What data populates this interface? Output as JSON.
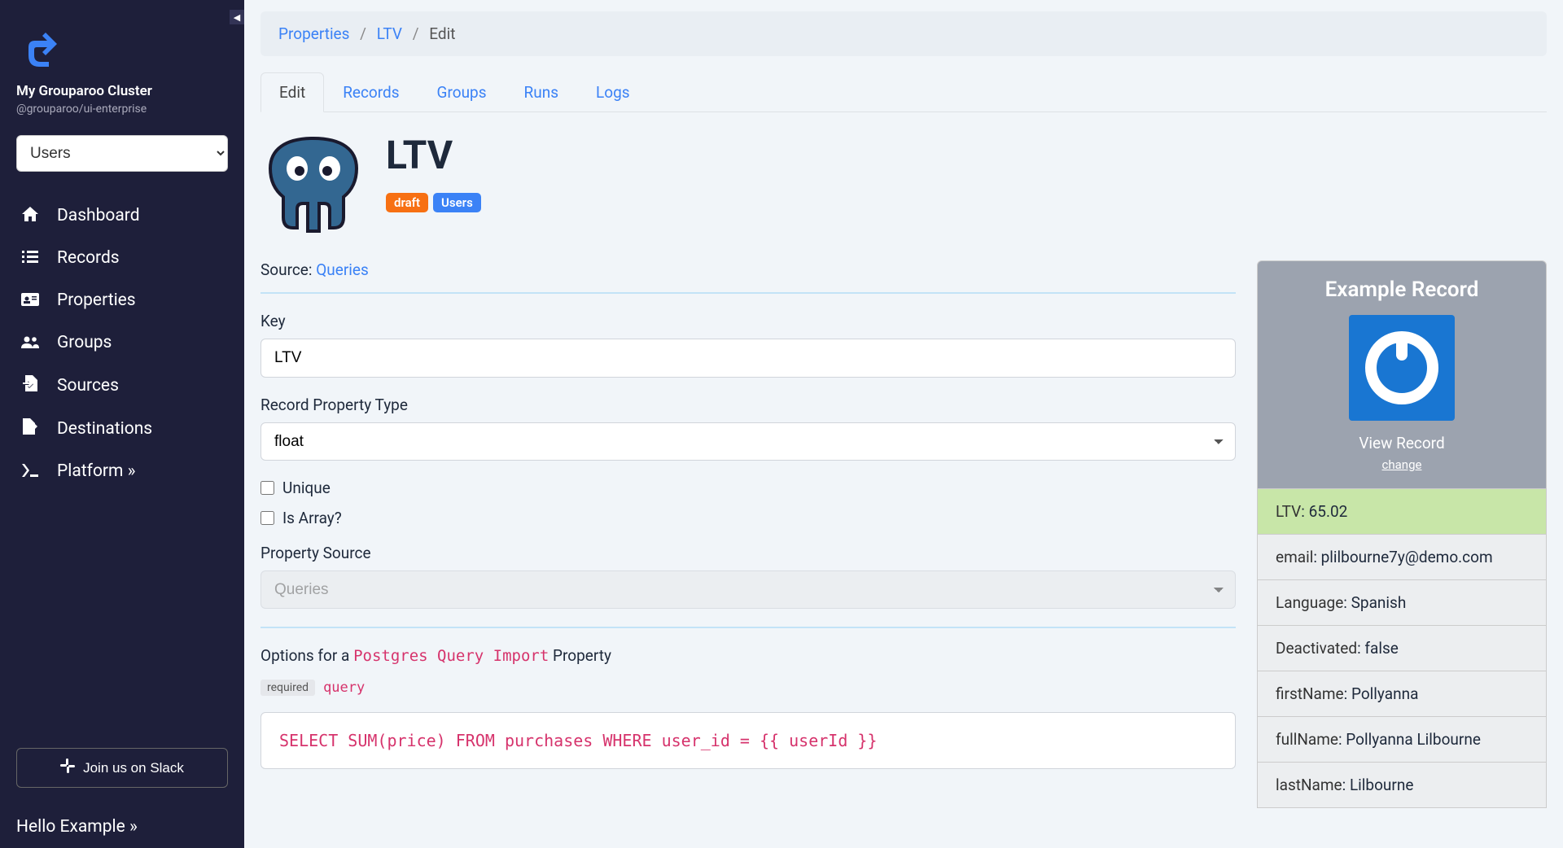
{
  "sidebar": {
    "cluster_name": "My Grouparoo Cluster",
    "cluster_sub": "@grouparoo/ui-enterprise",
    "model_selected": "Users",
    "nav": [
      {
        "label": "Dashboard",
        "icon": "home"
      },
      {
        "label": "Records",
        "icon": "list"
      },
      {
        "label": "Properties",
        "icon": "id-card"
      },
      {
        "label": "Groups",
        "icon": "users"
      },
      {
        "label": "Sources",
        "icon": "file-import"
      },
      {
        "label": "Destinations",
        "icon": "file-export"
      },
      {
        "label": "Platform »",
        "icon": "terminal"
      }
    ],
    "slack_label": "Join us on Slack",
    "hello": "Hello Example »"
  },
  "breadcrumb": {
    "items": [
      "Properties",
      "LTV",
      "Edit"
    ]
  },
  "tabs": [
    "Edit",
    "Records",
    "Groups",
    "Runs",
    "Logs"
  ],
  "active_tab": "Edit",
  "page": {
    "title": "LTV",
    "badge_draft": "draft",
    "badge_model": "Users",
    "source_label": "Source:",
    "source_name": "Queries"
  },
  "form": {
    "key_label": "Key",
    "key_value": "LTV",
    "type_label": "Record Property Type",
    "type_value": "float",
    "unique_label": "Unique",
    "array_label": "Is Array?",
    "property_source_label": "Property Source",
    "property_source_value": "Queries",
    "options_prefix": "Options for a ",
    "options_code": "Postgres Query Import",
    "options_suffix": " Property",
    "required_badge": "required",
    "query_label": "query",
    "query_value": "SELECT SUM(price) FROM purchases WHERE user_id = {{ userId }}"
  },
  "example": {
    "title": "Example Record",
    "view_label": "View Record",
    "change_label": "change",
    "rows": [
      {
        "key": "LTV",
        "value": "65.02",
        "highlight": true
      },
      {
        "key": "email",
        "value": "plilbourne7y@demo.com"
      },
      {
        "key": "Language",
        "value": "Spanish"
      },
      {
        "key": "Deactivated",
        "value": "false"
      },
      {
        "key": "firstName",
        "value": "Pollyanna"
      },
      {
        "key": "fullName",
        "value": "Pollyanna Lilbourne"
      },
      {
        "key": "lastName",
        "value": "Lilbourne"
      }
    ]
  }
}
